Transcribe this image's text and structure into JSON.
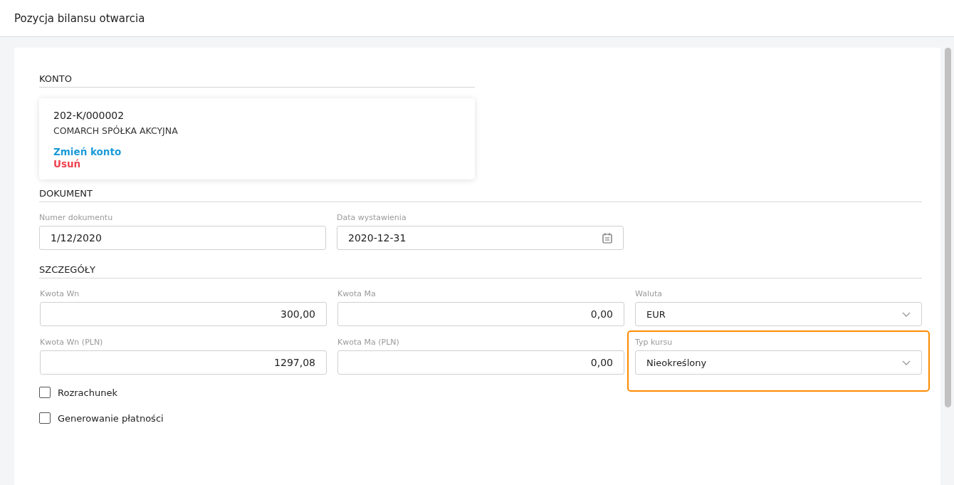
{
  "window": {
    "title": "Pozycja bilansu otwarcia"
  },
  "konto": {
    "heading": "KONTO",
    "number": "202-K/000002",
    "name": "COMARCH SPÓŁKA AKCYJNA",
    "links": [
      {
        "label": "Zmień konto",
        "kind": "change"
      },
      {
        "label": "Usuń",
        "kind": "delete"
      }
    ]
  },
  "dokument": {
    "heading": "DOKUMENT",
    "fields": [
      {
        "label": "Numer dokumentu",
        "value": "1/12/2020",
        "kind": "text",
        "highlighted": false
      },
      {
        "label": "Data wystawienia",
        "value": "2020-12-31",
        "kind": "date",
        "highlighted": false
      }
    ]
  },
  "szczegoly": {
    "heading": "SZCZEGÓŁY",
    "fields": [
      {
        "label": "Kwota Wn",
        "value": "300,00",
        "kind": "amount",
        "highlighted": false
      },
      {
        "label": "Kwota Ma",
        "value": "0,00",
        "kind": "amount",
        "highlighted": false
      },
      {
        "label": "Waluta",
        "value": "EUR",
        "kind": "select",
        "highlighted": false
      },
      {
        "label": "Kwota Wn (PLN)",
        "value": "1297,08",
        "kind": "amount",
        "highlighted": false
      },
      {
        "label": "Kwota Ma (PLN)",
        "value": "0,00",
        "kind": "amount",
        "highlighted": false
      },
      {
        "label": "Typ kursu",
        "value": "Nieokreślony",
        "kind": "select",
        "highlighted": true
      }
    ],
    "checkboxes": [
      {
        "label": "Rozrachunek",
        "checked": false
      },
      {
        "label": "Generowanie płatności",
        "checked": false
      }
    ]
  }
}
